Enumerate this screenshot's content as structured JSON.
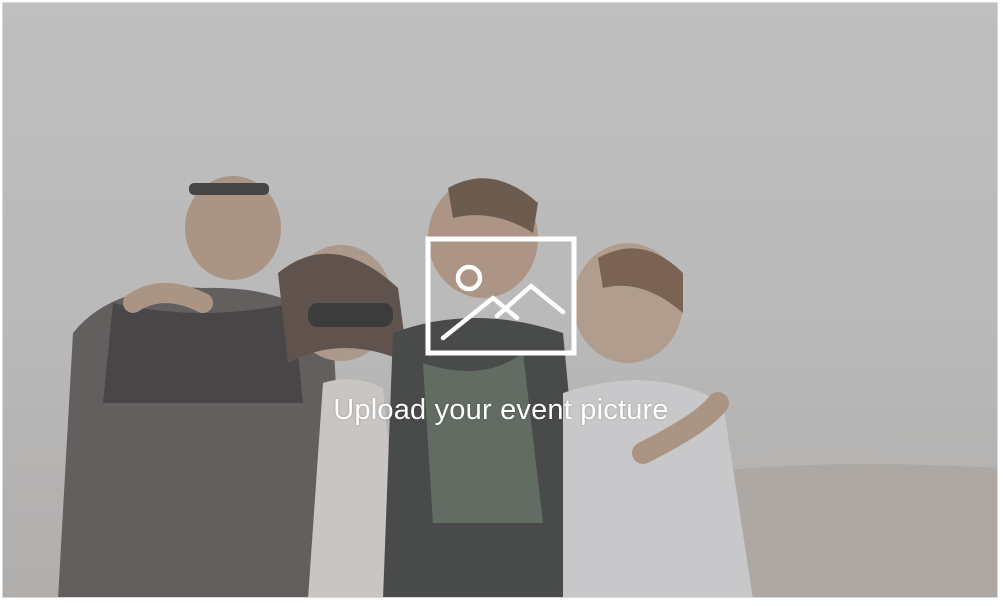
{
  "upload": {
    "label": "Upload your event picture",
    "icon": "image-icon"
  },
  "colors": {
    "overlay_text": "#ffffff",
    "border": "#d7d7d7"
  }
}
